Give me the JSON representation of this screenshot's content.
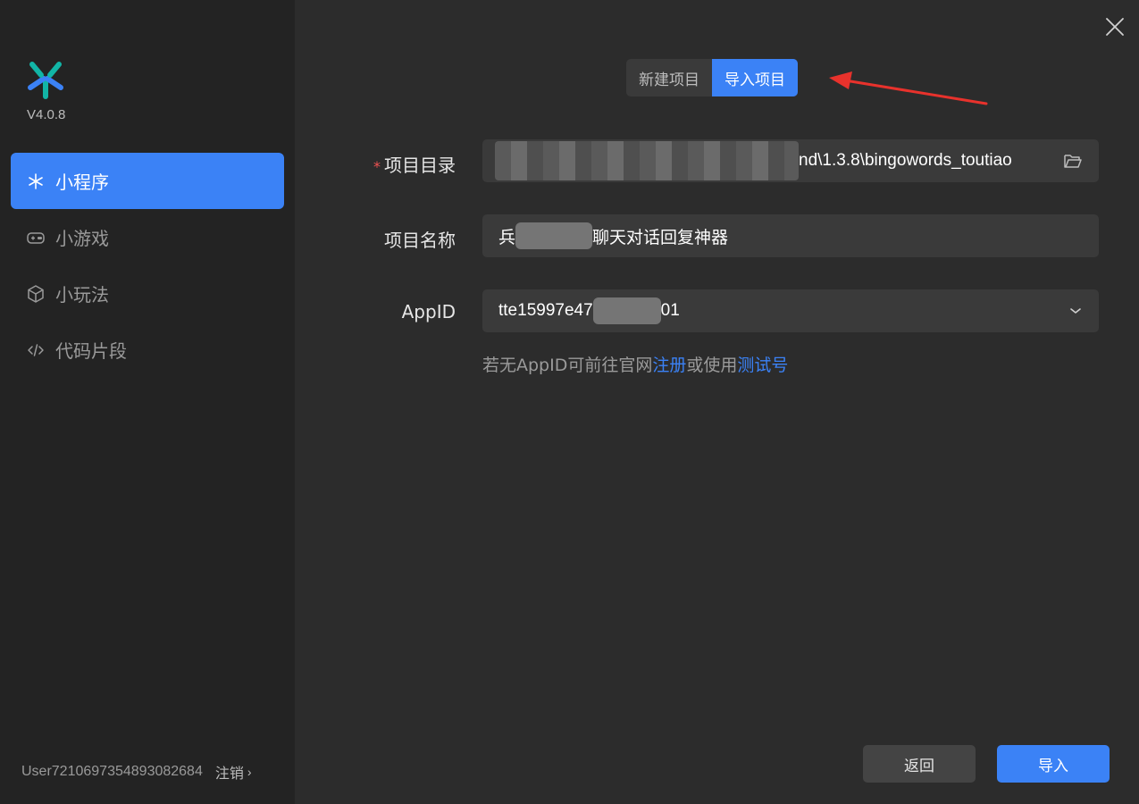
{
  "app": {
    "version": "V4.0.8"
  },
  "sidebar": {
    "items": [
      {
        "label": "小程序",
        "icon": "miniprogram-icon",
        "active": true
      },
      {
        "label": "小游戏",
        "icon": "gamepad-icon",
        "active": false
      },
      {
        "label": "小玩法",
        "icon": "cube-icon",
        "active": false
      },
      {
        "label": "代码片段",
        "icon": "code-icon",
        "active": false
      }
    ],
    "user": "User7210697354893082684",
    "logout_label": "注销",
    "logout_chevron": "›"
  },
  "tabs": {
    "new_project": "新建项目",
    "import_project": "导入项目",
    "active": "import_project"
  },
  "form": {
    "required_mark": "*",
    "dir_label": "项目目录",
    "dir_value": "nd\\1.3.8\\bingowords_toutiao",
    "name_label": "项目名称",
    "name_prefix": "兵",
    "name_suffix": "聊天对话回复神器",
    "appid_label": "AppID",
    "appid_prefix": "tte15997e47",
    "appid_suffix": "01",
    "hint_prefix": "若无AppID可前往官网",
    "hint_register": "注册",
    "hint_middle": "或使用",
    "hint_test": "测试号"
  },
  "footer": {
    "back_label": "返回",
    "import_label": "导入"
  },
  "colors": {
    "accent": "#3b82f6",
    "required": "#f05252",
    "annotation_arrow": "#e8322c"
  }
}
